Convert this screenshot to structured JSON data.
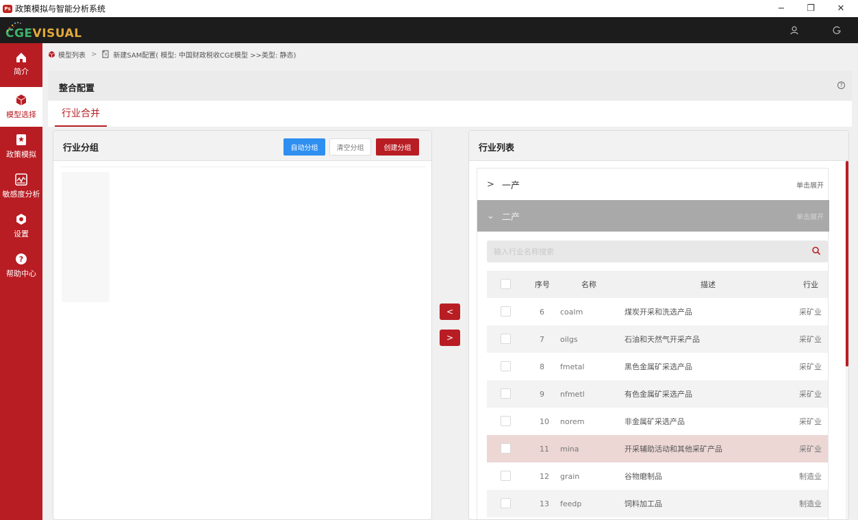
{
  "window": {
    "app_icon_text": "Ps",
    "title": "政策模拟与智能分析系统",
    "minimize": "−",
    "restore": "❐",
    "close": "✕"
  },
  "header": {
    "logo_text_cge": "CGE",
    "logo_text_visual": "VISUAL",
    "user_icon": "user-icon",
    "logout_icon": "logout-icon"
  },
  "sidebar": {
    "items": [
      {
        "label": "简介",
        "icon": "home-icon"
      },
      {
        "label": "模型选择",
        "icon": "cube-icon",
        "active": true
      },
      {
        "label": "政策模拟",
        "icon": "policy-icon"
      },
      {
        "label": "敏感度分析",
        "icon": "chart-icon"
      },
      {
        "label": "设置",
        "icon": "settings-icon"
      },
      {
        "label": "帮助中心",
        "icon": "help-icon"
      }
    ]
  },
  "breadcrumb": {
    "item1": "模型列表",
    "separator": ">",
    "item2": "新建SAM配置( 模型: 中国财政税收CGE模型 >>类型: 静态)"
  },
  "config": {
    "title": "整合配置",
    "help": "?"
  },
  "tabs": {
    "active": "行业合并"
  },
  "left_panel": {
    "title": "行业分组",
    "btn_auto": "自动分组",
    "btn_clear": "清空分组",
    "btn_create": "创建分组"
  },
  "transfer": {
    "left": "<",
    "right": ">"
  },
  "right_panel": {
    "title": "行业列表",
    "groups": [
      {
        "name": "一产",
        "hint": "单击展开",
        "chevron": ">"
      },
      {
        "name": "二产",
        "hint": "单击展开",
        "chevron": "⌄"
      }
    ],
    "search_placeholder": "输入行业名称搜索",
    "columns": {
      "index": "序号",
      "name": "名称",
      "desc": "描述",
      "industry": "行业"
    },
    "rows": [
      {
        "index": "6",
        "name": "coalm",
        "desc": "煤炭开采和洗选产品",
        "industry": "采矿业"
      },
      {
        "index": "7",
        "name": "oilgs",
        "desc": "石油和天然气开采产品",
        "industry": "采矿业"
      },
      {
        "index": "8",
        "name": "fmetal",
        "desc": "黑色金属矿采选产品",
        "industry": "采矿业"
      },
      {
        "index": "9",
        "name": "nfmetl",
        "desc": "有色金属矿采选产品",
        "industry": "采矿业"
      },
      {
        "index": "10",
        "name": "norem",
        "desc": "非金属矿采选产品",
        "industry": "采矿业"
      },
      {
        "index": "11",
        "name": "mina",
        "desc": "开采辅助活动和其他采矿产品",
        "industry": "采矿业"
      },
      {
        "index": "12",
        "name": "grain",
        "desc": "谷物磨制品",
        "industry": "制造业"
      },
      {
        "index": "13",
        "name": "feedp",
        "desc": "饲料加工品",
        "industry": "制造业"
      }
    ]
  },
  "colors": {
    "brand_red": "#b81d23",
    "accent_blue": "#2e8ff0",
    "header_dark": "#1c1c1c",
    "row_highlight": "#ecd7d5"
  }
}
